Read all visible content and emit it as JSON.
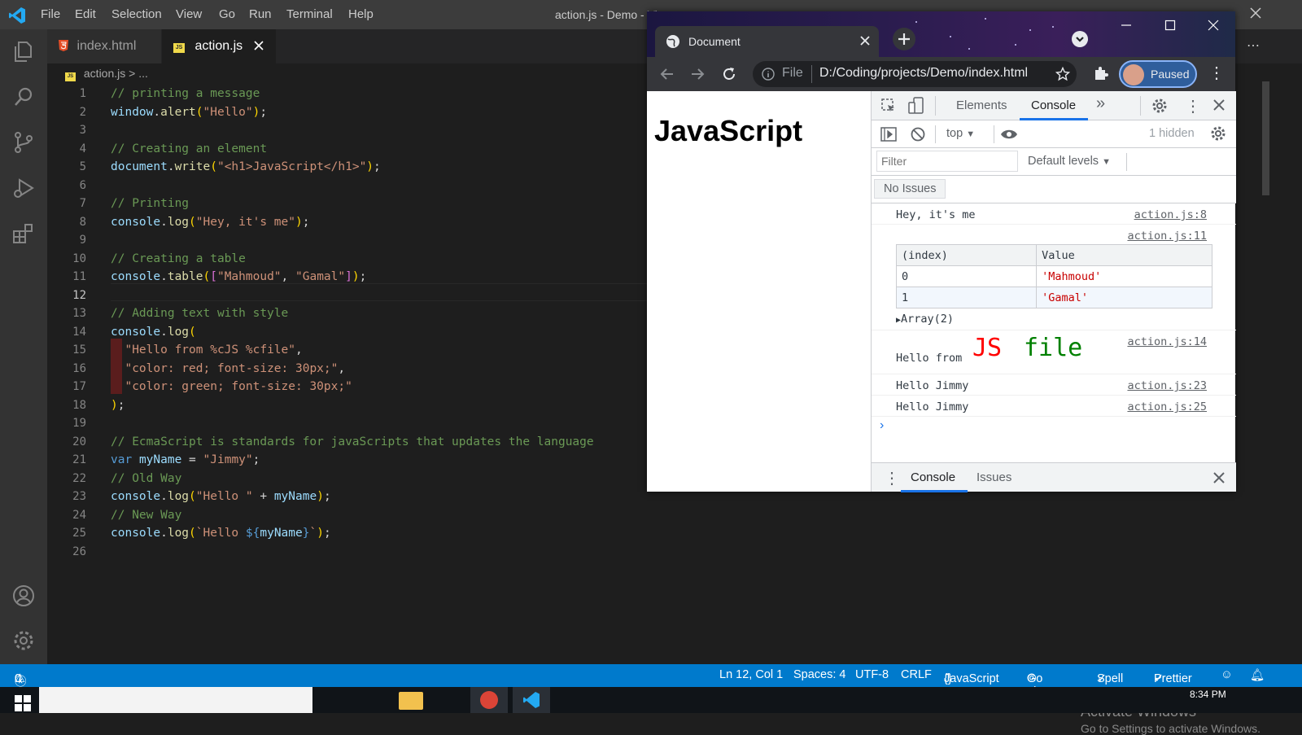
{
  "vscode": {
    "title": "action.js - Demo - Vi",
    "menu": [
      "File",
      "Edit",
      "Selection",
      "View",
      "Go",
      "Run",
      "Terminal",
      "Help"
    ],
    "tabs": [
      {
        "label": "index.html",
        "icon": "html5-icon"
      },
      {
        "label": "action.js",
        "icon": "js-icon",
        "active": true
      }
    ],
    "breadcrumb": {
      "file": "action.js",
      "rest": "..."
    },
    "lines": [
      "// printing a message",
      "window.alert(\"Hello\");",
      "",
      "// Creating an element",
      "document.write(\"<h1>JavaScript</h1>\");",
      "",
      "// Printing",
      "console.log(\"Hey, it's me\");",
      "",
      "// Creating a table",
      "console.table([\"Mahmoud\", \"Gamal\"]);",
      "",
      "// Adding text with style",
      "console.log(",
      "  \"Hello from %cJS %cfile\",",
      "  \"color: red; font-size: 30px;\",",
      "  \"color: green; font-size: 30px;\"",
      ");",
      "",
      "// EcmaScript is standards for javaScripts that updates the language",
      "var myName = \"Jimmy\";",
      "// Old Way",
      "console.log(\"Hello \" + myName);",
      "// New Way",
      "console.log(`Hello ${myName}`);",
      ""
    ],
    "current_line": 12,
    "activate_windows": {
      "title": "Activate Windows",
      "subtitle": "Go to Settings to activate Windows."
    },
    "status": {
      "errors": "0",
      "warnings": "0",
      "position": "Ln 12, Col 1",
      "spaces": "Spaces: 4",
      "encoding": "UTF-8",
      "eol": "CRLF",
      "language": "JavaScript",
      "golive": "Go Live",
      "spell": "Spell",
      "prettier": "Prettier"
    },
    "taskbar_time": "8:34 PM"
  },
  "chrome": {
    "tab_title": "Document",
    "scheme": "File",
    "url": "D:/Coding/projects/Demo/index.html",
    "profile_status": "Paused",
    "page_heading": "JavaScript",
    "devtools": {
      "tabs": [
        "Elements",
        "Console"
      ],
      "active_tab": "Console",
      "context": "top",
      "hidden": "1 hidden",
      "filter_placeholder": "Filter",
      "levels": "Default levels",
      "issues_button": "No Issues",
      "messages": [
        {
          "text": "Hey, it's me",
          "source": "action.js:8"
        },
        {
          "source": "action.js:11"
        },
        {
          "text_prefix": "Hello from",
          "styled_1": "JS",
          "styled_2": "file",
          "source": "action.js:14"
        },
        {
          "text": "Hello Jimmy",
          "source": "action.js:23"
        },
        {
          "text": "Hello Jimmy",
          "source": "action.js:25"
        }
      ],
      "table": {
        "headers": [
          "(index)",
          "Value"
        ],
        "rows": [
          [
            "0",
            "'Mahmoud'"
          ],
          [
            "1",
            "'Gamal'"
          ]
        ],
        "summary": "Array(2)"
      },
      "drawer_tabs": [
        "Console",
        "Issues"
      ]
    }
  },
  "colors": {
    "status_blue": "#007acc",
    "js_red": "#ff0000",
    "js_green": "#008000",
    "string_red": "#c80000"
  }
}
